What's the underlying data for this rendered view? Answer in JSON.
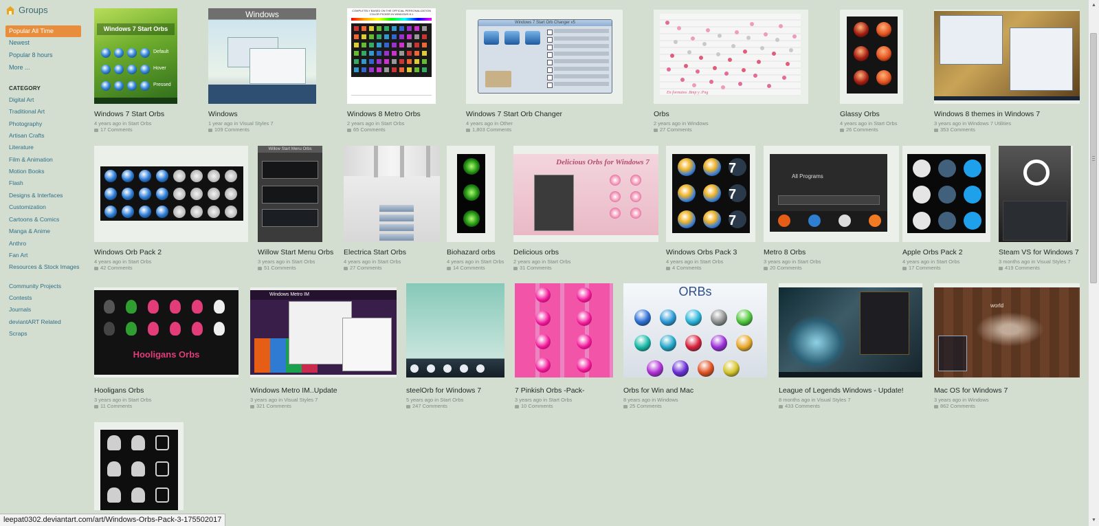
{
  "sidebar": {
    "groups_label": "Groups",
    "nav": [
      "Popular All Time",
      "Newest",
      "Popular 8 hours",
      "More ..."
    ],
    "active_index": 0,
    "category_heading": "CATEGORY",
    "categories": [
      "Digital Art",
      "Traditional Art",
      "Photography",
      "Artisan Crafts",
      "Literature",
      "Film & Animation",
      "Motion Books",
      "Flash",
      "Designs & Interfaces",
      "Customization",
      "Cartoons & Comics",
      "Manga & Anime",
      "Anthro",
      "Fan Art",
      "Resources & Stock Images",
      "Community Projects",
      "Contests",
      "Journals",
      "deviantART Related",
      "Scraps"
    ]
  },
  "items": [
    {
      "title": "Windows 7 Start Orbs",
      "meta": "4 years ago in Start Orbs",
      "comments": "17 Comments",
      "thumb": "green-orbs",
      "thumb_text": "Windows 7 Start Orbs"
    },
    {
      "title": "Windows",
      "meta": "1 year ago in Visual Styles 7",
      "comments": "109 Comments",
      "thumb": "win-desktop",
      "thumb_text": "Windows"
    },
    {
      "title": "Windows 8 Metro Orbs",
      "meta": "2 years ago in Start Orbs",
      "comments": "65 Comments",
      "thumb": "metro-grid",
      "thumb_text": "COMPLETELY BASED ON THE OFFICIAL PERSONALIZATION COLOR PICKER IN WINDOWS 8.1"
    },
    {
      "title": "Windows 7 Start Orb Changer",
      "meta": "4 years ago in Other",
      "comments": "1,803 Comments",
      "thumb": "changer",
      "thumb_text": "Windows 7 Start Orb Changer v5"
    },
    {
      "title": "Orbs",
      "meta": "2 years ago in Windows",
      "comments": "27 Comments",
      "thumb": "pink-sheet",
      "thumb_text": "En formatos .Bmp y .Png"
    },
    {
      "title": "Glassy Orbs",
      "meta": "4 years ago in Start Orbs",
      "comments": "26 Comments",
      "thumb": "glassy",
      "thumb_text": ""
    },
    {
      "title": "Windows 8 themes in Windows 7",
      "meta": "3 years ago in Windows 7 Utilities",
      "comments": "353 Comments",
      "thumb": "themes",
      "thumb_text": ""
    },
    {
      "title": "Windows Orb Pack 2",
      "meta": "4 years ago in Start Orbs",
      "comments": "42 Comments",
      "thumb": "orb-pack2",
      "thumb_text": ""
    },
    {
      "title": "Willow Start Menu Orbs",
      "meta": "3 years ago in Start Orbs",
      "comments": "51 Comments",
      "thumb": "willow",
      "thumb_text": "Willow Start Menu Orbs"
    },
    {
      "title": "Electrica Start Orbs",
      "meta": "4 years ago in Start Orbs",
      "comments": "27 Comments",
      "thumb": "electrica",
      "thumb_text": ""
    },
    {
      "title": "Biohazard orbs",
      "meta": "4 years ago in Start Orbs",
      "comments": "14 Comments",
      "thumb": "biohazard",
      "thumb_text": ""
    },
    {
      "title": "Delicious orbs",
      "meta": "2 years ago in Start Orbs",
      "comments": "31 Comments",
      "thumb": "delicious",
      "thumb_text": "Delicious Orbs for Windows 7"
    },
    {
      "title": "Windows Orbs Pack 3",
      "meta": "4 years ago in Start Orbs",
      "comments": "4 Comments",
      "thumb": "orb-pack3",
      "thumb_text": ""
    },
    {
      "title": "Metro 8 Orbs",
      "meta": "3 years ago in Start Orbs",
      "comments": "20 Comments",
      "thumb": "metro8",
      "thumb_text": "All Programs"
    },
    {
      "title": "Apple Orbs Pack 2",
      "meta": "4 years ago in Start Orbs",
      "comments": "17 Comments",
      "thumb": "apple",
      "thumb_text": ""
    },
    {
      "title": "Steam VS for Windows 7",
      "meta": "3 months ago in Visual Styles 7",
      "comments": "419 Comments",
      "thumb": "steam",
      "thumb_text": ""
    },
    {
      "title": "Hooligans Orbs",
      "meta": "3 years ago in Start Orbs",
      "comments": "11 Comments",
      "thumb": "hooligans",
      "thumb_text": "Hooligans Orbs"
    },
    {
      "title": "Windows Metro IM..Update",
      "meta": "3 years ago in Visual Styles 7",
      "comments": "321 Comments",
      "thumb": "metro-im",
      "thumb_text": "Windows Metro IM"
    },
    {
      "title": "steelOrb for Windows 7",
      "meta": "5 years ago in Start Orbs",
      "comments": "247 Comments",
      "thumb": "steel",
      "thumb_text": ""
    },
    {
      "title": "7 Pinkish Orbs -Pack-",
      "meta": "3 years ago in Start Orbs",
      "comments": "10 Comments",
      "thumb": "pinkish",
      "thumb_text": ""
    },
    {
      "title": "Orbs for Win and Mac",
      "meta": "8 years ago in Windows",
      "comments": "25 Comments",
      "thumb": "orbs-mac",
      "thumb_text": "ORBs"
    },
    {
      "title": "League of Legends Windows - Update!",
      "meta": "8 months ago in Visual Styles 7",
      "comments": "433 Comments",
      "thumb": "lol",
      "thumb_text": ""
    },
    {
      "title": "Mac OS for Windows 7",
      "meta": "3 years ago in Windows",
      "comments": "862 Comments",
      "thumb": "macos",
      "thumb_text": "world"
    },
    {
      "title": "",
      "meta": "",
      "comments": "",
      "thumb": "android",
      "thumb_text": ""
    }
  ],
  "status_url": "leepat0302.deviantart.com/art/Windows-Orbs-Pack-3-175502017",
  "colors": {
    "background": "#d3ded1",
    "accent": "#e78d3c",
    "link": "#2e6f86"
  }
}
